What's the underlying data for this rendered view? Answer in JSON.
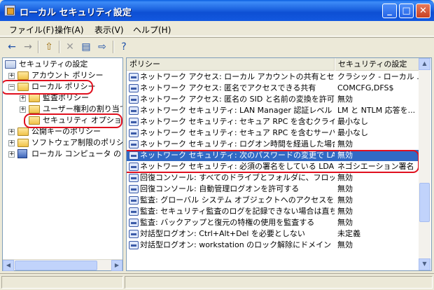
{
  "window": {
    "title": "ローカル セキュリティ設定",
    "minimize_glyph": "_",
    "maximize_glyph": "□",
    "close_glyph": "✕"
  },
  "menu": [
    "ファイル(F)",
    "操作(A)",
    "表示(V)",
    "ヘルプ(H)"
  ],
  "toolbar": {
    "back_icon": "←",
    "forward_icon": "→",
    "up_icon": "⇧",
    "delete_icon": "✕",
    "properties_icon": "▤",
    "export_icon": "⇨",
    "help_icon": "?"
  },
  "tree": {
    "root": "セキュリティの設定",
    "items": [
      "アカウント ポリシー",
      "ローカル ポリシー",
      "監査ポリシー",
      "ユーザー権利の割り当て",
      "セキュリティ オプション",
      "公開キーのポリシー",
      "ソフトウェア制限のポリシー",
      "ローカル コンピュータ の IP"
    ],
    "toggle_plus": "+",
    "toggle_minus": "−"
  },
  "list": {
    "col_policy": "ポリシー",
    "col_setting": "セキュリティの設定",
    "rows": [
      {
        "name": "ネットワーク アクセス: ローカル アカウントの共有とセキュリ...",
        "value": "クラシック - ローカル ..."
      },
      {
        "name": "ネットワーク アクセス: 匿名でアクセスできる共有",
        "value": "COMCFG,DFS$"
      },
      {
        "name": "ネットワーク アクセス: 匿名の SID と名前の変換を許可す...",
        "value": "無効"
      },
      {
        "name": "ネットワーク セキュリティ: LAN Manager 認証レベル",
        "value": "LM と NTLM 応答を..."
      },
      {
        "name": "ネットワーク セキュリティ: セキュア RPC を含むクライアント...",
        "value": "最小なし"
      },
      {
        "name": "ネットワーク セキュリティ: セキュア RPC を含むサーバー ベ...",
        "value": "最小なし"
      },
      {
        "name": "ネットワーク セキュリティ: ログオン時間を経過した場合はユ...",
        "value": "無効"
      },
      {
        "name": "ネットワーク セキュリティ: 次のパスワードの変更で LAN マ...",
        "value": "無効"
      },
      {
        "name": "ネットワーク セキュリティ: 必須の署名をしている LDAP ク...",
        "value": "ネゴシエーション署名"
      },
      {
        "name": "回復コンソール: すべてのドライブとフォルダに、フロッピーの...",
        "value": "無効"
      },
      {
        "name": "回復コンソール: 自動管理ログオンを許可する",
        "value": "無効"
      },
      {
        "name": "監査: グローバル システム オブジェクトへのアクセスを監査...",
        "value": "無効"
      },
      {
        "name": "監査: セキュリティ監査のログを記録できない場合は直ちに...",
        "value": "無効"
      },
      {
        "name": "監査: バックアップと復元の特権の使用を監査する",
        "value": "無効"
      },
      {
        "name": "対話型ログオン: Ctrl+Alt+Del を必要としない",
        "value": "未定義"
      },
      {
        "name": "対話型ログオン: workstation のロック解除にドメイン コン...",
        "value": "無効"
      }
    ],
    "selected_index": 7
  },
  "scrollbar": {
    "up": "▲",
    "down": "▼",
    "left": "◀",
    "right": "▶"
  },
  "colors": {
    "highlight_ring": "#e0101e",
    "selection": "#316ac5",
    "titlebar": "#0d4fd3"
  }
}
